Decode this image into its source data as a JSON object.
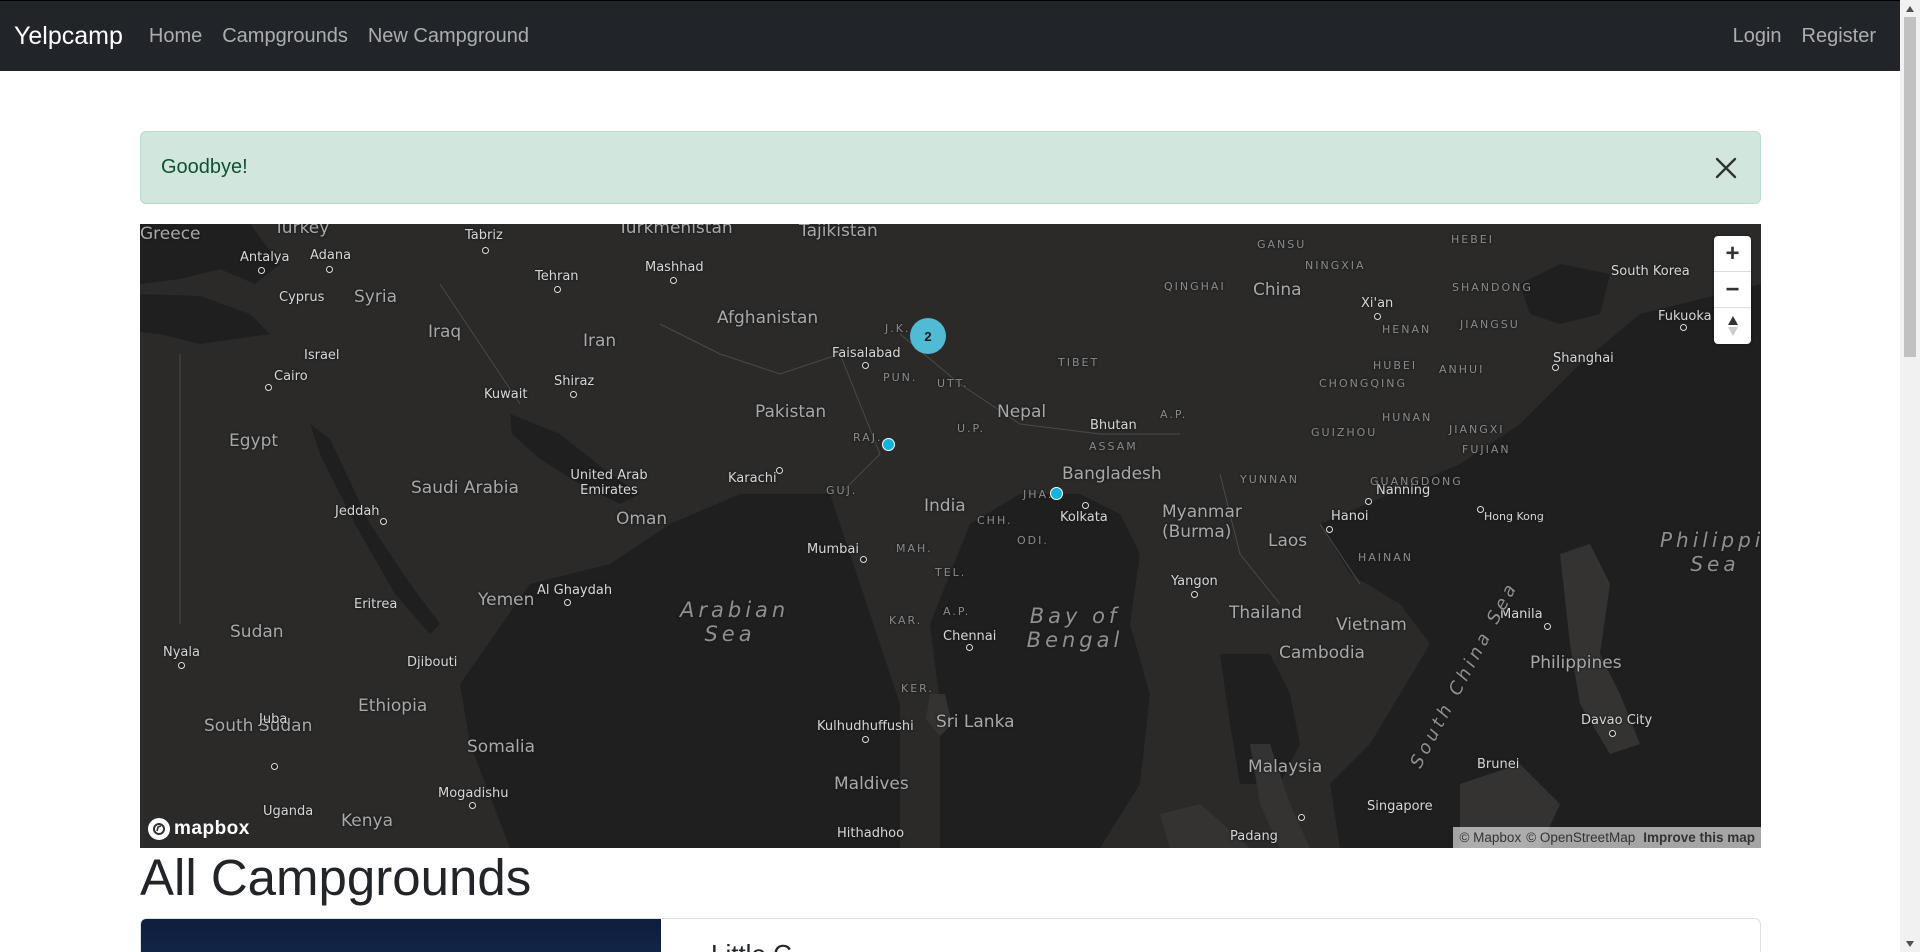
{
  "navbar": {
    "brand": "Yelpcamp",
    "links": [
      "Home",
      "Campgrounds",
      "New Campground"
    ],
    "right_links": [
      "Login",
      "Register"
    ]
  },
  "alert": {
    "message": "Goodbye!"
  },
  "map": {
    "controls": [
      "+",
      "−",
      "▲"
    ],
    "cluster_count": "2",
    "logo_text": "mapbox",
    "attribution": {
      "mapbox": "© Mapbox",
      "osm": "© OpenStreetMap",
      "improve": "Improve this map"
    },
    "labels": {
      "countries": [
        "Greece",
        "Turkey",
        "Syria",
        "Iraq",
        "Iran",
        "Turkmenistan",
        "Tajikistan",
        "Afghanistan",
        "Pakistan",
        "Egypt",
        "Saudi Arabia",
        "United Arab Emirates",
        "Oman",
        "Yemen",
        "Eritrea",
        "Sudan",
        "Djibouti",
        "Ethiopia",
        "South Sudan",
        "Somalia",
        "Uganda",
        "Kenya",
        "India",
        "Nepal",
        "Bhutan",
        "Bangladesh",
        "Myanmar (Burma)",
        "Laos",
        "Thailand",
        "Vietnam",
        "Cambodia",
        "Sri Lanka",
        "Maldives",
        "Malaysia",
        "China",
        "South Korea",
        "Philippines",
        "Brunei",
        "Israel",
        "Kuwait",
        "Cyprus"
      ],
      "cities": [
        "Antalya",
        "Adana",
        "Tabriz",
        "Tehran",
        "Mashhad",
        "Shiraz",
        "Cairo",
        "Faisalabad",
        "Karachi",
        "Jeddah",
        "Al Ghaydah",
        "Mumbai",
        "Kolkata",
        "Chennai",
        "Hanoi",
        "Xi'an",
        "Shanghai",
        "Fukuoka",
        "Hong Kong",
        "Nanning",
        "Yangon",
        "Manila",
        "Davao City",
        "Kulhudhuffushi",
        "Hithadhoo",
        "Mogadishu",
        "Juba",
        "Nyala",
        "Singapore",
        "Padang"
      ],
      "states": [
        "J.K.",
        "PUN.",
        "UTT.",
        "U.P.",
        "RAJ.",
        "GUJ.",
        "MAH.",
        "CHH.",
        "ODI.",
        "JHA.",
        "TEL.",
        "A.P.",
        "KAR.",
        "KER.",
        "ASSAM",
        "A.P.",
        "TIBET",
        "GANSU",
        "NINGXIA",
        "QINGHAI",
        "HEBEI",
        "SHANDONG",
        "HENAN",
        "JIANGSU",
        "HUBEI",
        "ANHUI",
        "CHONGQING",
        "HUNAN",
        "JIANGXI",
        "GUIZHOU",
        "FUJIAN",
        "YUNNAN",
        "GUANGDONG",
        "HAINAN"
      ],
      "seas": [
        "Arabian Sea",
        "Bay of Bengal",
        "South China Sea",
        "Philippine Sea"
      ]
    }
  },
  "page": {
    "heading": "All Campgrounds"
  },
  "card": {
    "title": "Little C..."
  }
}
